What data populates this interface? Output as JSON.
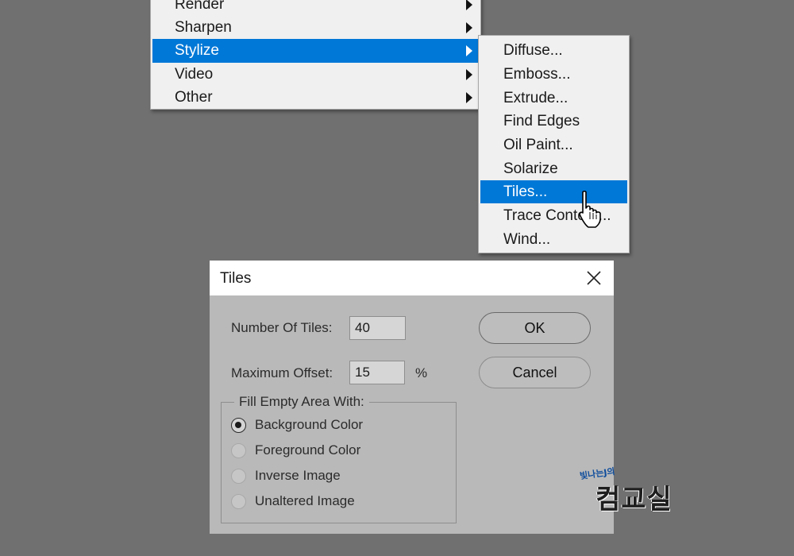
{
  "filter_menu": {
    "items": [
      {
        "label": "Render"
      },
      {
        "label": "Sharpen"
      },
      {
        "label": "Stylize"
      },
      {
        "label": "Video"
      },
      {
        "label": "Other"
      }
    ]
  },
  "stylize_submenu": {
    "items": [
      {
        "label": "Diffuse..."
      },
      {
        "label": "Emboss..."
      },
      {
        "label": "Extrude..."
      },
      {
        "label": "Find Edges"
      },
      {
        "label": "Oil Paint..."
      },
      {
        "label": "Solarize"
      },
      {
        "label": "Tiles..."
      },
      {
        "label": "Trace Contour..."
      },
      {
        "label": "Wind..."
      }
    ]
  },
  "dialog": {
    "title": "Tiles",
    "number_of_tiles_label": "Number Of Tiles:",
    "number_of_tiles_value": "40",
    "maximum_offset_label": "Maximum Offset:",
    "maximum_offset_value": "15",
    "offset_unit": "%",
    "ok_label": "OK",
    "cancel_label": "Cancel",
    "fill_group_label": "Fill Empty Area With:",
    "fill_options": [
      {
        "label": "Background Color",
        "selected": true
      },
      {
        "label": "Foreground Color",
        "selected": false
      },
      {
        "label": "Inverse Image",
        "selected": false
      },
      {
        "label": "Unaltered Image",
        "selected": false
      }
    ]
  },
  "watermark": {
    "small": "빛나는J의",
    "big": "컴교실"
  },
  "colors": {
    "highlight": "#0078d7",
    "dialog_bg": "#b9b9b9",
    "desktop_bg": "#707070"
  }
}
